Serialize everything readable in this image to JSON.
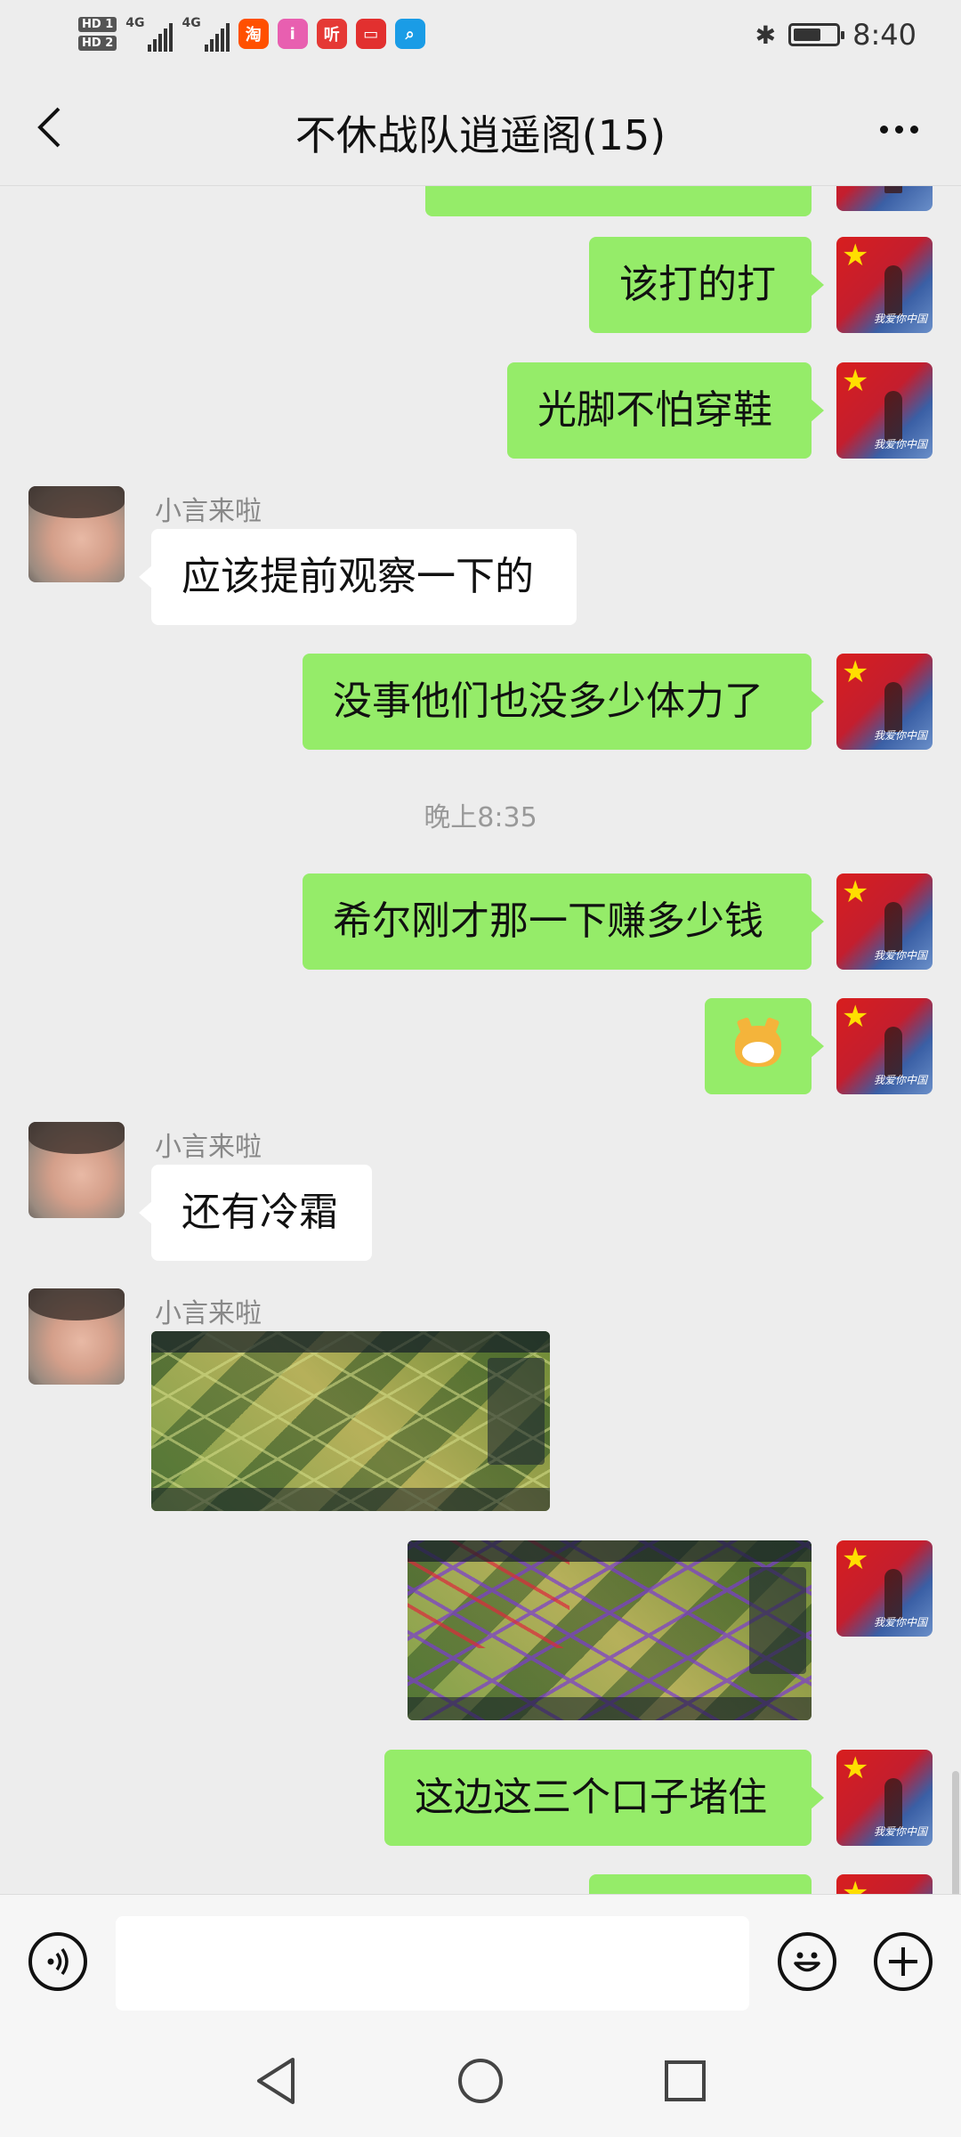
{
  "status_bar": {
    "sim1": "HD 1",
    "sim2": "HD 2",
    "network1": "4G",
    "network2": "4G",
    "app_icons": [
      {
        "name": "taobao-icon",
        "glyph": "淘",
        "color": "#ff5000"
      },
      {
        "name": "app-i-icon",
        "glyph": "i",
        "color": "#e85fb0"
      },
      {
        "name": "listen-icon",
        "glyph": "听",
        "color": "#e53935"
      },
      {
        "name": "huawei-mall-icon",
        "glyph": "▭",
        "color": "#e2302f"
      },
      {
        "name": "search-app-icon",
        "glyph": "⌕",
        "color": "#1a9ce6"
      }
    ],
    "time": "8:40"
  },
  "header": {
    "title": "不休战队逍遥阁(15)"
  },
  "chat": {
    "timestamp": "晚上8:35",
    "sender_name": "小言来啦",
    "messages": [
      {
        "text": "该打的打"
      },
      {
        "text": "光脚不怕穿鞋"
      },
      {
        "text": "应该提前观察一下的"
      },
      {
        "text": "没事他们也没多少体力了"
      },
      {
        "text": "希尔刚才那一下赚多少钱"
      },
      {
        "text": "还有冷霜"
      },
      {
        "text": "这边这三个口子堵住"
      }
    ]
  },
  "colors": {
    "my_bubble": "#95ec69",
    "their_bubble": "#ffffff",
    "background": "#ededed"
  }
}
